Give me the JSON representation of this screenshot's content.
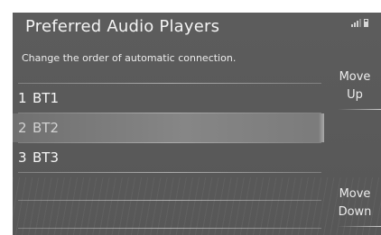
{
  "header": {
    "title": "Preferred Audio Players",
    "signal_icon": "signal-bars-icon",
    "battery_icon": "battery-icon"
  },
  "subtitle": "Change the order of automatic connection.",
  "players": [
    {
      "number": "1",
      "name": "BT1",
      "selected": false
    },
    {
      "number": "2",
      "name": "BT2",
      "selected": true
    },
    {
      "number": "3",
      "name": "BT3",
      "selected": false
    }
  ],
  "buttons": {
    "move_up": {
      "line1": "Move",
      "line2": "Up"
    },
    "move_down": {
      "line1": "Move",
      "line2": "Down"
    }
  },
  "colors": {
    "panel_bg": "#5a5a5a",
    "text": "#f2f2f2",
    "selected_bg": "#808080"
  }
}
